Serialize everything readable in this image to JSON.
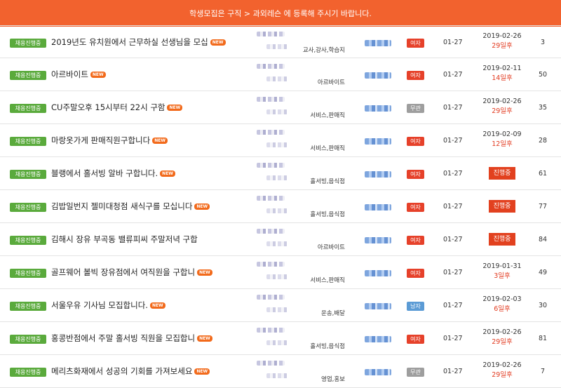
{
  "banner": {
    "text": "학생모집은 구직 > 과외레슨 에 등록해 주시기 바랍니다."
  },
  "new_badge": "NEW",
  "rows": [
    {
      "status": "채용진행중",
      "title": "2019년도 유치원에서 근무하실 선생님을 모십",
      "new": true,
      "job": "교사,강사,학습지",
      "gender": "여자",
      "gender_type": "f",
      "posted": "01-27",
      "deadline": "2019-02-26",
      "remaining": "29일후",
      "progress": "",
      "views": "3"
    },
    {
      "status": "채용진행중",
      "title": "아르바이트",
      "new": true,
      "job": "아르바이트",
      "gender": "여자",
      "gender_type": "f",
      "posted": "01-27",
      "deadline": "2019-02-11",
      "remaining": "14일후",
      "progress": "",
      "views": "50"
    },
    {
      "status": "채용진행중",
      "title": "CU주말오후 15시부터 22시 구함",
      "new": true,
      "job": "서비스,판매직",
      "gender": "무관",
      "gender_type": "any",
      "posted": "01-27",
      "deadline": "2019-02-26",
      "remaining": "29일후",
      "progress": "",
      "views": "35"
    },
    {
      "status": "채용진행중",
      "title": "마랑옷가게 판매직원구합니다",
      "new": true,
      "job": "서비스,판매직",
      "gender": "여자",
      "gender_type": "f",
      "posted": "01-27",
      "deadline": "2019-02-09",
      "remaining": "12일후",
      "progress": "",
      "views": "28"
    },
    {
      "status": "채용진행중",
      "title": "블랭에서 홀서빙 알바 구합니다.",
      "new": true,
      "job": "홀서빙,음식점",
      "gender": "여자",
      "gender_type": "f",
      "posted": "01-27",
      "deadline": "",
      "remaining": "",
      "progress": "진행중",
      "views": "61"
    },
    {
      "status": "채용진행중",
      "title": "김밥일번지 젤미대청점 새식구를 모십니다",
      "new": true,
      "job": "홀서빙,음식점",
      "gender": "여자",
      "gender_type": "f",
      "posted": "01-27",
      "deadline": "",
      "remaining": "",
      "progress": "진행중",
      "views": "77"
    },
    {
      "status": "채용진행중",
      "title": "김해시 장유 부곡동 밸류피씨 주말저녁 구합",
      "new": false,
      "job": "아르바이트",
      "gender": "여자",
      "gender_type": "f",
      "posted": "01-27",
      "deadline": "",
      "remaining": "",
      "progress": "진행중",
      "views": "84"
    },
    {
      "status": "채용진행중",
      "title": "골프웨어 볼빅 장유점에서 여직원을 구합니",
      "new": true,
      "job": "서비스,판매직",
      "gender": "여자",
      "gender_type": "f",
      "posted": "01-27",
      "deadline": "2019-01-31",
      "remaining": "3일후",
      "progress": "",
      "views": "49"
    },
    {
      "status": "채용진행중",
      "title": "서울우유 기사님 모집합니다.",
      "new": true,
      "job": "운송,배달",
      "gender": "남자",
      "gender_type": "m",
      "posted": "01-27",
      "deadline": "2019-02-03",
      "remaining": "6일후",
      "progress": "",
      "views": "30"
    },
    {
      "status": "채용진행중",
      "title": "홍콩반점에서 주말 홀서빙 직원을 모집합니",
      "new": true,
      "job": "홀서빙,음식점",
      "gender": "여자",
      "gender_type": "f",
      "posted": "01-27",
      "deadline": "2019-02-26",
      "remaining": "29일후",
      "progress": "",
      "views": "81"
    },
    {
      "status": "채용진행중",
      "title": "메리츠화재에서 성공의 기회를 가져보세요",
      "new": true,
      "job": "영업,홍보",
      "gender": "무관",
      "gender_type": "any",
      "posted": "01-27",
      "deadline": "2019-02-26",
      "remaining": "29일후",
      "progress": "",
      "views": "7"
    }
  ]
}
